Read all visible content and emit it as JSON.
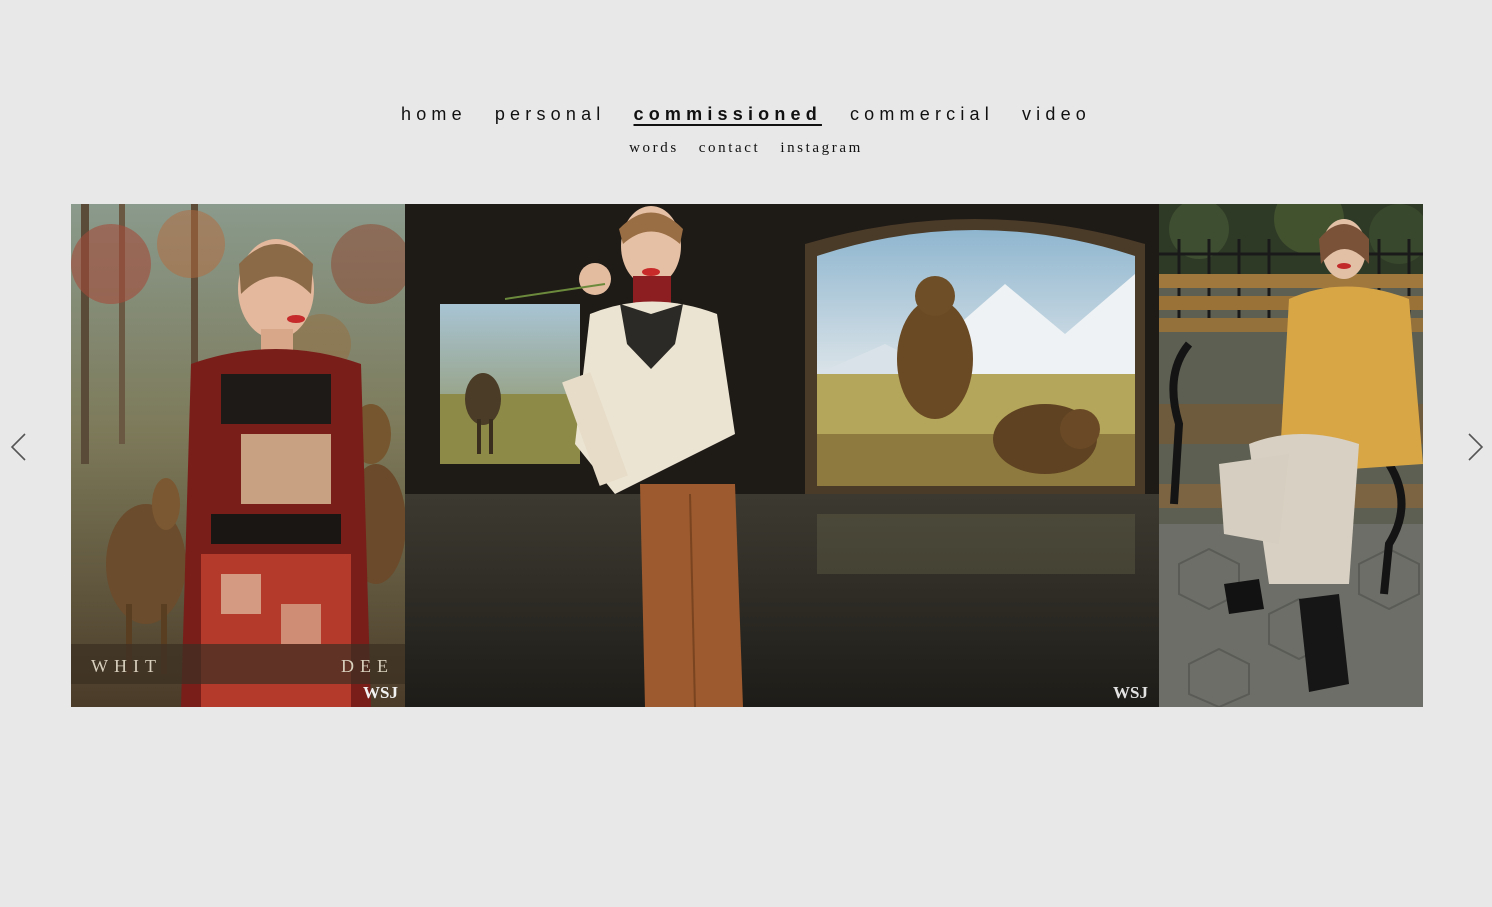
{
  "nav": {
    "primary": [
      {
        "label": "home",
        "active": false
      },
      {
        "label": "personal",
        "active": false
      },
      {
        "label": "commissioned",
        "active": true
      },
      {
        "label": "commercial",
        "active": false
      },
      {
        "label": "video",
        "active": false
      }
    ],
    "secondary": [
      {
        "label": "words"
      },
      {
        "label": "contact"
      },
      {
        "label": "instagram"
      }
    ]
  },
  "gallery": {
    "photos": [
      {
        "subject": "model in patchwork red dress in front of deer diorama",
        "overlay_text": "WHIT",
        "overlay_text_2": "DEE",
        "logo": "WSJ"
      },
      {
        "subject": "smiling model in cream blouse and brown trousers in museum hall with bear diorama",
        "logo": "WSJ"
      },
      {
        "subject": "model in mustard leather jacket seated on park bench"
      }
    ]
  },
  "controls": {
    "prev_icon": "chevron-left-icon",
    "next_icon": "chevron-right-icon"
  },
  "colors": {
    "background": "#e8e8e8",
    "text": "#111111"
  }
}
